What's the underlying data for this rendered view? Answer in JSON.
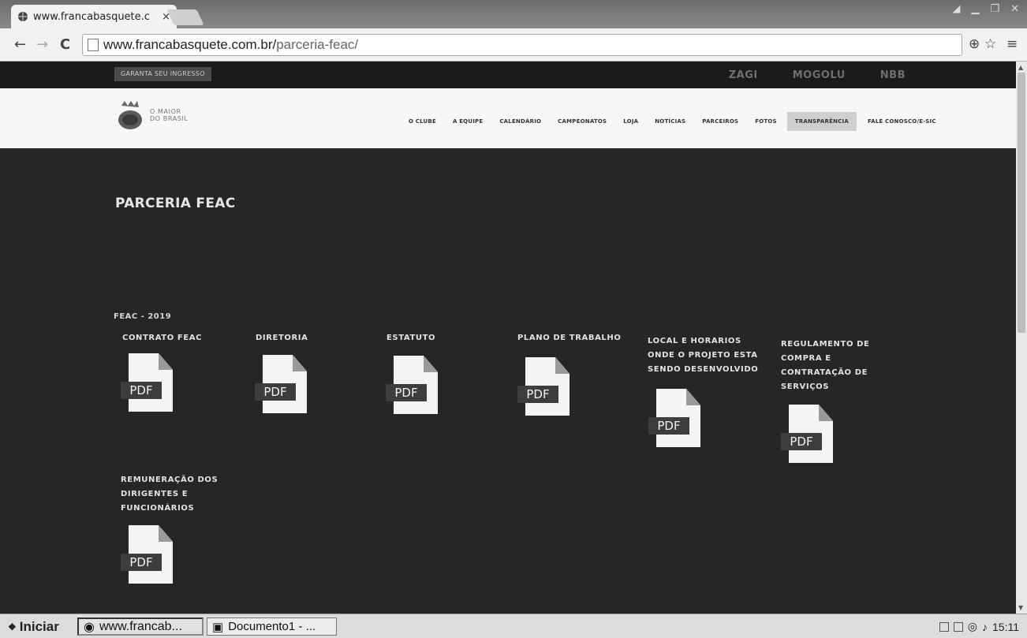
{
  "browser": {
    "tab_title": "www.francabasquete.c",
    "tab_close": "×",
    "url_domain": "www.francabasquete.com.br/",
    "url_path": "parceria-feac/",
    "back": "←",
    "forward": "→",
    "reload": "C",
    "zoom_icon": "⊕",
    "star_icon": "☆",
    "menu_icon": "≡"
  },
  "site": {
    "guarantee_label": "GARANTA SEU INGRESSO",
    "sponsors": [
      "ZAGI",
      "MOGOLU",
      "NBB"
    ],
    "slogan_line1": "O MAIOR",
    "slogan_line2": "DO BRASIL",
    "menu": [
      "O CLUBE",
      "A EQUIPE",
      "CALENDÁRIO",
      "CAMPEONATOS",
      "LOJA",
      "NOTÍCIAS",
      "PARCEIROS",
      "FOTOS",
      "TRANSPARÊNCIA",
      "FALE CONOSCO/E-SIC"
    ]
  },
  "page": {
    "title": "PARCERIA FEAC",
    "year_label": "FEAC - 2019",
    "pdf_label": "PDF",
    "documents": [
      {
        "title": "CONTRATO FEAC"
      },
      {
        "title": "DIRETORIA"
      },
      {
        "title": "ESTATUTO"
      },
      {
        "title": "PLANO DE TRABALHO"
      },
      {
        "title": "LOCAL E HORARIOS ONDE O PROJETO ESTA SENDO DESENVOLVIDO"
      },
      {
        "title": "REGULAMENTO DE COMPRA E CONTRATAÇÃO DE SERVIÇOS"
      },
      {
        "title": "REMUNERAÇÃO DOS DIRIGENTES E FUNCIONÁRIOS"
      }
    ]
  },
  "taskbar": {
    "start_label": "Iniciar",
    "tasks": [
      "www.francab...",
      "Documento1 - ..."
    ],
    "clock": "15:11"
  }
}
